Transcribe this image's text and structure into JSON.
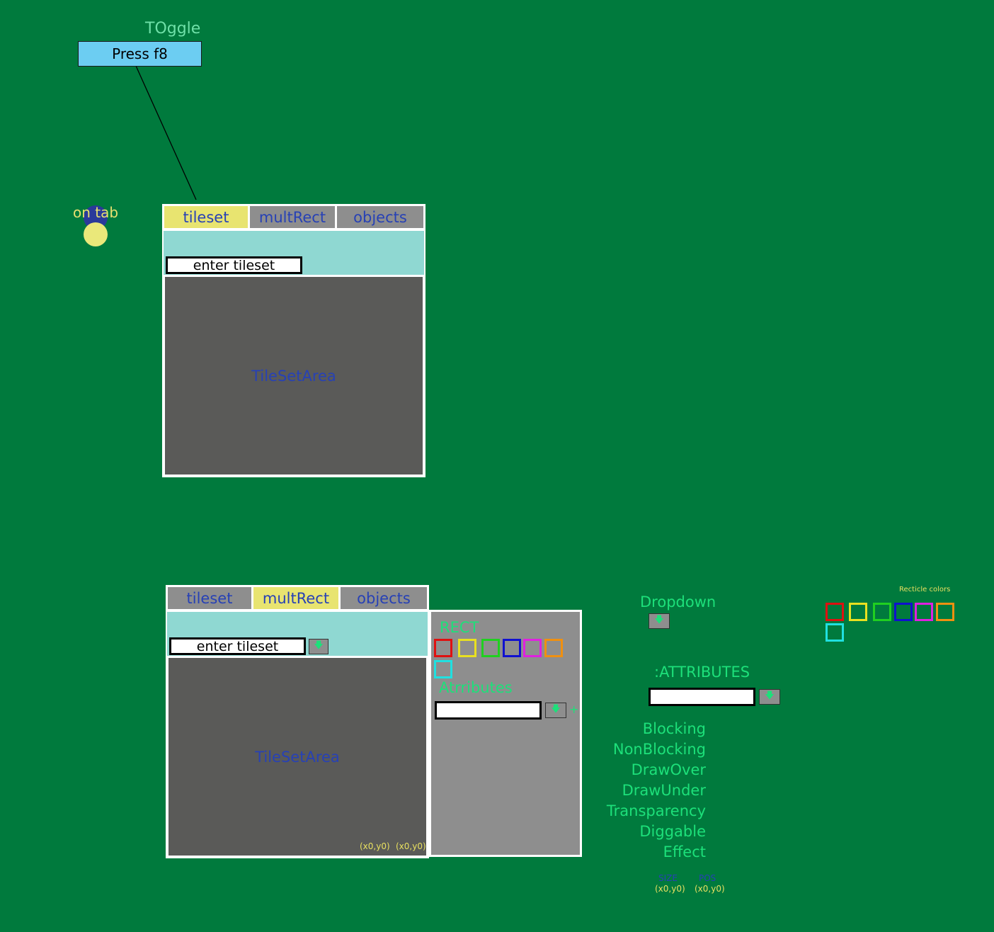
{
  "toggle": {
    "title": "TOggle",
    "button_label": "Press f8"
  },
  "on_tab_label": "on tab",
  "panel_top": {
    "tabs": [
      "tileset",
      "multRect",
      "objects"
    ],
    "active_tab": "tileset",
    "input_value": "enter tileset",
    "area_label": "TileSetArea"
  },
  "panel_bottom": {
    "tabs": [
      "tileset",
      "multRect",
      "objects"
    ],
    "active_tab": "multRect",
    "input_value": "enter tileset",
    "area_label": "TileSetArea",
    "coord_size": "(x0,y0)",
    "coord_pos": "(x0,y0)"
  },
  "side_panel": {
    "rect_label": "RECT",
    "attributes_label": "Atrributes",
    "attributes_input_value": "",
    "plus_label": "+",
    "swatch_colors": [
      "#e01010",
      "#e8e020",
      "#20d020",
      "#1010d0",
      "#e020e0",
      "#f09010",
      "#20e0e0"
    ]
  },
  "dropdown": {
    "label": "Dropdown"
  },
  "attributes": {
    "title": ":ATTRIBUTES",
    "input_value": "",
    "items": [
      "Blocking",
      "NonBlocking",
      "DrawOver",
      "DrawUnder",
      "Transparency",
      "Diggable",
      "Effect"
    ]
  },
  "size_pos": {
    "size_label": "SIZE",
    "pos_label": "POS",
    "size_value": "(x0,y0)",
    "pos_value": "(x0,y0)"
  },
  "recticle": {
    "label": "Recticle colors",
    "colors": [
      "#e01010",
      "#e8e020",
      "#20d020",
      "#1010d0",
      "#e020e0",
      "#f09010",
      "#20e0e0"
    ]
  },
  "icons": {
    "dropdown_arrow": "down-arrow-icon"
  }
}
